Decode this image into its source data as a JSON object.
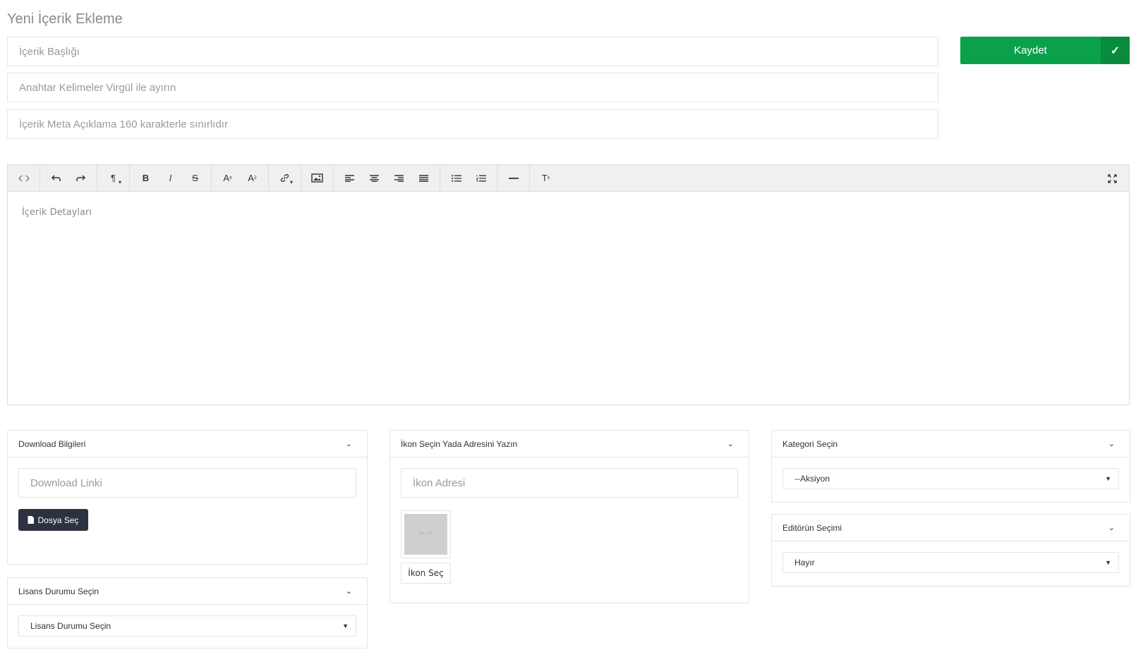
{
  "page": {
    "title": "Yeni İçerik Ekleme"
  },
  "form": {
    "title_placeholder": "İçerik Başlığı",
    "keywords_placeholder": "Anahtar Kelimeler Virgül ile ayırın",
    "meta_placeholder": "İçerik Meta Açıklama 160 karakterle sınırlıdır",
    "save_label": "Kaydet",
    "save_icon": "✓"
  },
  "colors": {
    "accent": "#0aa14a",
    "accent_dark": "#088a3f",
    "dark_button": "#2c3240"
  },
  "editor": {
    "toolbar": [
      [
        "code-view-icon"
      ],
      [
        "undo-icon",
        "redo-icon"
      ],
      [
        "paragraph-icon"
      ],
      [
        "bold-icon",
        "italic-icon",
        "strikethrough-icon"
      ],
      [
        "superscript-icon",
        "subscript-icon"
      ],
      [
        "link-icon"
      ],
      [
        "image-icon"
      ],
      [
        "align-left-icon",
        "align-center-icon",
        "align-right-icon",
        "align-justify-icon"
      ],
      [
        "bullet-list-icon",
        "numbered-list-icon"
      ],
      [
        "horizontal-rule-icon"
      ],
      [
        "clear-format-icon"
      ]
    ],
    "fullscreen_icon": "fullscreen-icon",
    "placeholder": "İçerik Detayları"
  },
  "panels": {
    "download": {
      "title": "Download Bilgileri",
      "link_placeholder": "Download Linki",
      "file_button": "Dosya Seç"
    },
    "license": {
      "title": "Lisans Durumu Seçin",
      "selected": "Lisans Durumu Seçin"
    },
    "icon": {
      "title": "İkon Seçin Yada Adresini Yazın",
      "address_placeholder": "İkon Adresi",
      "thumb_label": "70 x 70",
      "button": "İkon Seç"
    },
    "category": {
      "title": "Kategori Seçin",
      "selected": "--Aksiyon"
    },
    "editors_choice": {
      "title": "Editörün Seçimi",
      "selected": "Hayır"
    }
  }
}
